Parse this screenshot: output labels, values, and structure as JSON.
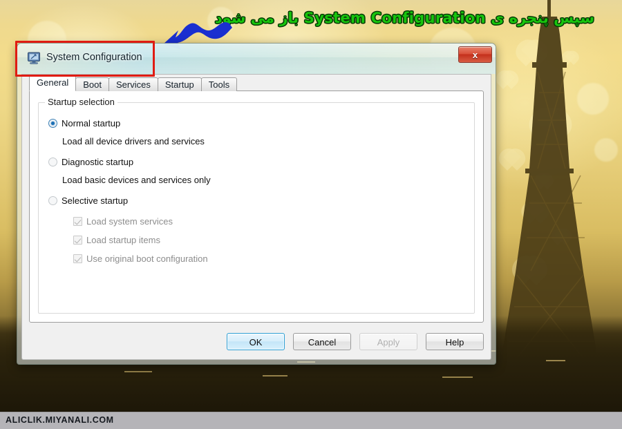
{
  "annotation": {
    "caption_text": "سپس پنجره ی System Configuration باز می شود",
    "caption_color": "#18c40d",
    "caption_outline_color": "#063a05",
    "arrow_color": "#1a2fd0",
    "highlight_box_color": "#e01b12"
  },
  "window": {
    "title": "System Configuration",
    "icon": "computer-monitor-icon",
    "close_label": "x",
    "tabs": [
      {
        "label": "General",
        "active": true
      },
      {
        "label": "Boot",
        "active": false
      },
      {
        "label": "Services",
        "active": false
      },
      {
        "label": "Startup",
        "active": false
      },
      {
        "label": "Tools",
        "active": false
      }
    ],
    "general_tab": {
      "group_legend": "Startup selection",
      "options": [
        {
          "label": "Normal startup",
          "description": "Load all device drivers and services",
          "selected": true
        },
        {
          "label": "Diagnostic startup",
          "description": "Load basic devices and services only",
          "selected": false
        },
        {
          "label": "Selective startup",
          "description": "",
          "selected": false
        }
      ],
      "checkboxes": [
        {
          "label": "Load system services",
          "checked": true,
          "disabled": true
        },
        {
          "label": "Load startup items",
          "checked": true,
          "disabled": true
        },
        {
          "label": "Use original boot configuration",
          "checked": true,
          "disabled": true
        }
      ]
    },
    "buttons": [
      {
        "label": "OK",
        "state": "default"
      },
      {
        "label": "Cancel",
        "state": "normal"
      },
      {
        "label": "Apply",
        "state": "disabled"
      },
      {
        "label": "Help",
        "state": "normal"
      }
    ]
  },
  "watermark": {
    "text": "ALICLIK.MIYANALI.COM"
  }
}
